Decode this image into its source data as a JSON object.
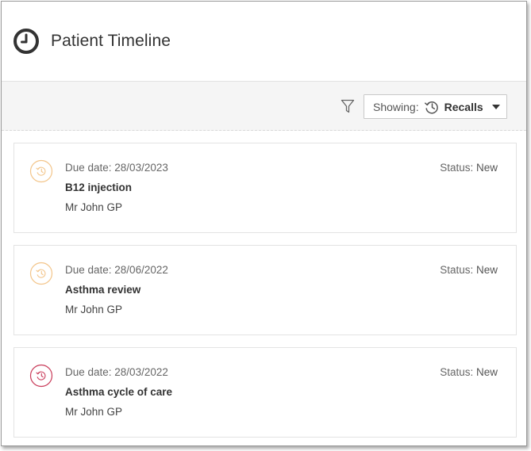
{
  "header": {
    "title": "Patient Timeline",
    "icon": "clock-icon"
  },
  "toolbar": {
    "filter_icon": "filter-icon",
    "showing_label": "Showing:",
    "showing_value": "Recalls",
    "showing_icon": "history-icon"
  },
  "colors": {
    "recall_due": "#f3c58a",
    "recall_overdue": "#c93c5a"
  },
  "recalls": [
    {
      "due_label": "Due date: 28/03/2023",
      "name": "B12 injection",
      "clinician": "Mr John GP",
      "status_label": "Status:",
      "status_value": "New",
      "badge_color": "#f3c58a"
    },
    {
      "due_label": "Due date: 28/06/2022",
      "name": "Asthma review",
      "clinician": "Mr John GP",
      "status_label": "Status:",
      "status_value": "New",
      "badge_color": "#f3c58a"
    },
    {
      "due_label": "Due date: 28/03/2022",
      "name": "Asthma cycle of care",
      "clinician": "Mr John GP",
      "status_label": "Status:",
      "status_value": "New",
      "badge_color": "#c93c5a"
    }
  ]
}
